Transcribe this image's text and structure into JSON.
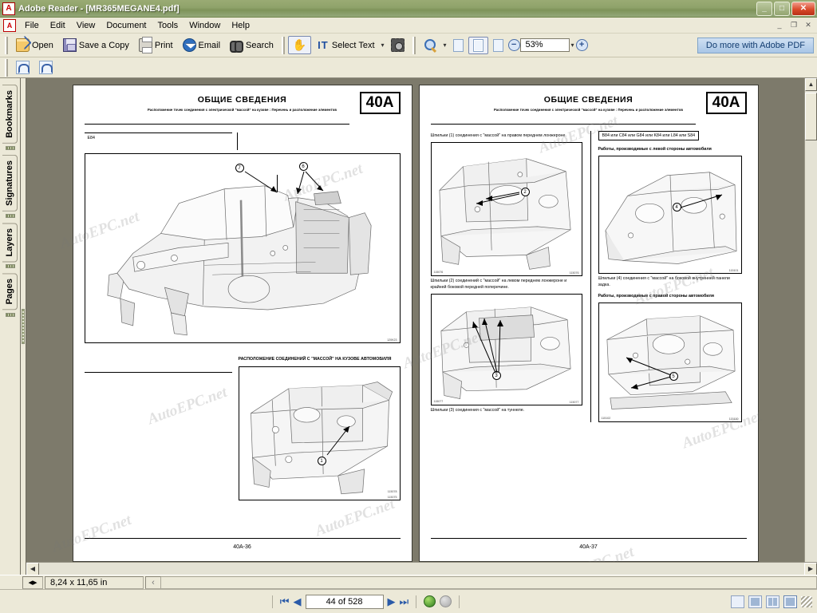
{
  "window": {
    "app_title": "Adobe Reader - [MR365MEGANE4.pdf]",
    "app_icon": "adobe-reader-icon",
    "minimize": "_",
    "maximize": "□",
    "close": "✕",
    "doc_minimize": "_",
    "doc_restore": "❐",
    "doc_close": "✕"
  },
  "menu": {
    "items": [
      {
        "label": "File"
      },
      {
        "label": "Edit"
      },
      {
        "label": "View"
      },
      {
        "label": "Document"
      },
      {
        "label": "Tools"
      },
      {
        "label": "Window"
      },
      {
        "label": "Help"
      }
    ]
  },
  "toolbar": {
    "open": "Open",
    "save_a_copy": "Save a Copy",
    "print": "Print",
    "email": "Email",
    "search": "Search",
    "hand_tool": "✋",
    "select_text": "Select Text",
    "select_text_caret": "▾",
    "snapshot_caret": "▾",
    "zoom_caret": "▾",
    "zoom_out": "−",
    "zoom_in": "+",
    "zoom_value": "53%",
    "zoom_list_caret": "▾",
    "do_more": "Do more with Adobe PDF"
  },
  "navpane": {
    "tabs": [
      {
        "label": "Bookmarks"
      },
      {
        "label": "Signatures"
      },
      {
        "label": "Layers"
      },
      {
        "label": "Pages"
      }
    ]
  },
  "document": {
    "left_page": {
      "title": "ОБЩИЕ СВЕДЕНИЯ",
      "subtitle": "Расположение точек соединения с электрической \"массой\" на кузове : Перечень и расположение элементов",
      "section_code": "40A",
      "variant_box": "E84",
      "fig1_code": "120K23",
      "fig1_callouts": [
        "7",
        "6"
      ],
      "caption_bottom": "РАСПОЛОЖЕНИЕ СОЕДИНЕНИЙ С \"МАССОЙ\" НА КУЗОВЕ АВТОМОБИЛЯ",
      "fig2_code": "115075",
      "fig2_code2": "115078",
      "fig2_callouts": [
        "1"
      ],
      "footer": "40A-36"
    },
    "right_page": {
      "title": "ОБЩИЕ СВЕДЕНИЯ",
      "subtitle": "Расположение точек соединения с электрической \"массой\" на кузове : Перечень и расположение элементов",
      "section_code": "40A",
      "caption_1": "Шпильки (1) соединения с \"массой\" на правом переднем лонжероне.",
      "fig1_code": "115076",
      "fig1_callouts": [
        "2"
      ],
      "caption_2": "Шпильки (2) соединений с \"массой\" на левом переднем лонжероне и крайней боковой передней поперечине.",
      "fig2_code": "115077",
      "fig2_callouts": [
        "3"
      ],
      "caption_3": "Шпильки (3) соединения с \"массой\" на туннеле.",
      "variant_box": "B84 или C84 или G84 или K84 или L84 или S84",
      "caption_left_side": "Работы, производимые с левой стороны автомобиля",
      "fig3_code": "115101",
      "fig3_callouts": [
        "4"
      ],
      "caption_4": "Шпильки (4) соединения с \"массой\" на боковой внутренней панели задка.",
      "caption_right_side": "Работы, производимые с правой стороны автомобиля",
      "fig4_code": "115100",
      "fig4_code2": "115102",
      "fig4_callouts": [
        "5"
      ],
      "footer": "40A-37"
    },
    "watermark": "AutoEPC.net"
  },
  "statusbar": {
    "page_size": "8,24 x 11,65 in",
    "resize_icon": "◂▸",
    "collapse_icon": "‹"
  },
  "pagenav": {
    "first": "⏮",
    "prev": "◀",
    "page_value": "44 of 528",
    "next": "▶",
    "last": "⏭",
    "back": "←",
    "forward": "→",
    "layout_single": "single-page-view",
    "layout_continuous": "continuous-view",
    "layout_facing": "facing-view",
    "layout_continuous_facing": "continuous-facing-view"
  }
}
